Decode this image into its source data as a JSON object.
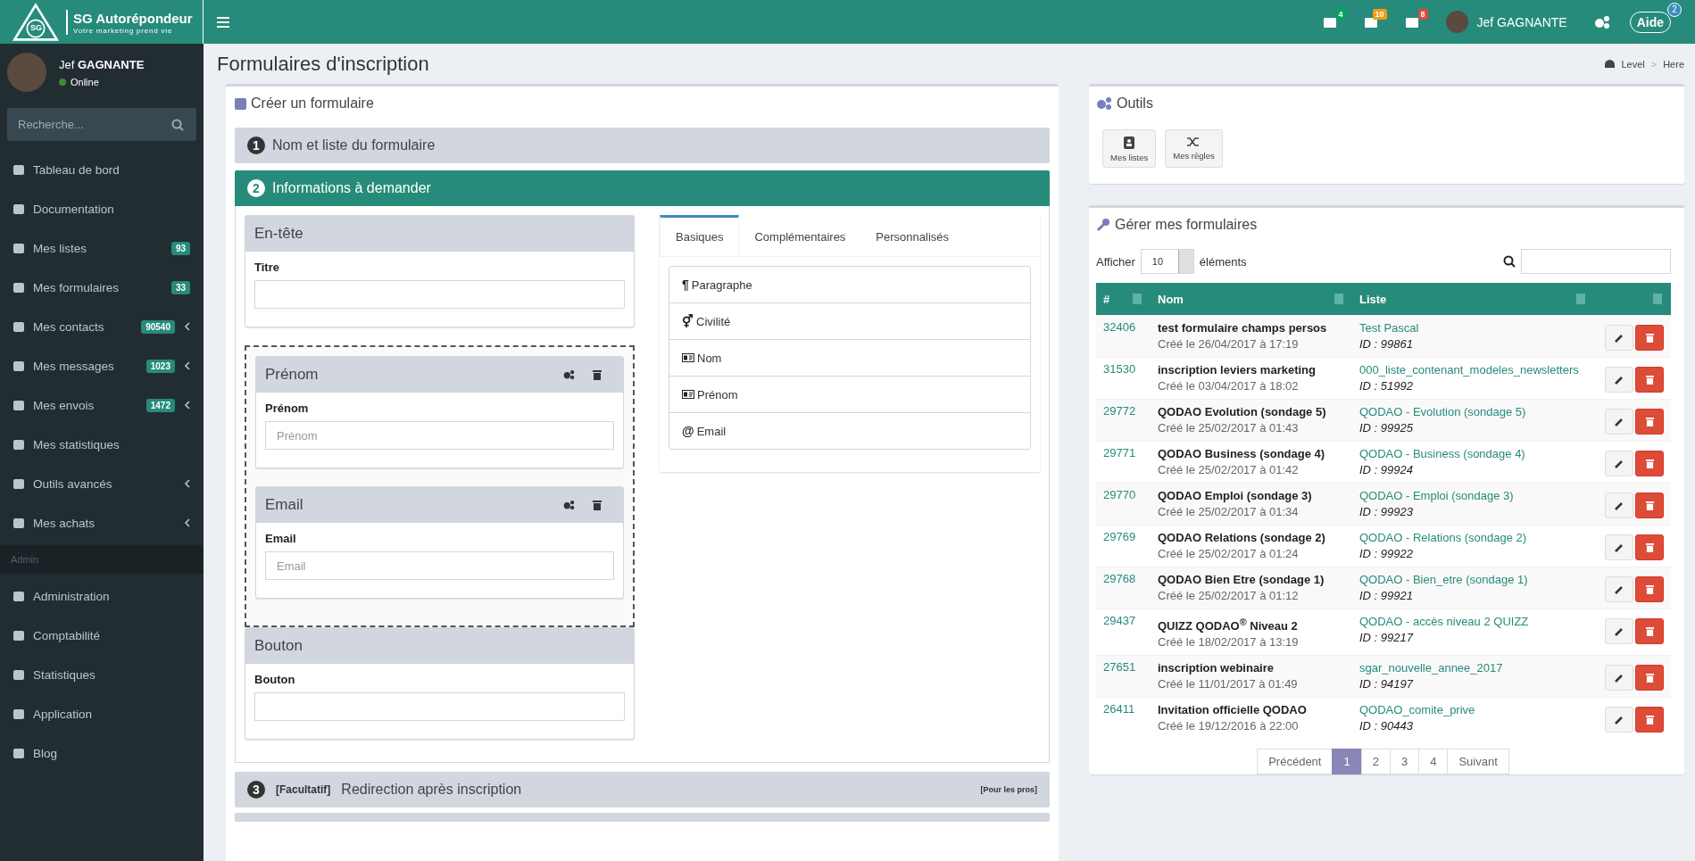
{
  "brand": {
    "mark": "SG",
    "name": "SG Autorépondeur",
    "tagline": "Votre marketing prend vie"
  },
  "topbar": {
    "notifications": [
      {
        "count": "4",
        "color": "#00a65a"
      },
      {
        "count": "10",
        "color": "#f39c12"
      },
      {
        "count": "8",
        "color": "#dd4b39"
      }
    ],
    "user": "Jef GAGNANTE",
    "help": {
      "label": "Aide",
      "badge": "2"
    }
  },
  "sidebar": {
    "user": {
      "first": "Jef",
      "last": "GAGNANTE",
      "status": "Online"
    },
    "search": {
      "placeholder": "Recherche..."
    },
    "items": [
      {
        "label": "Tableau de bord",
        "expandable": false
      },
      {
        "label": "Documentation",
        "expandable": false
      },
      {
        "label": "Mes listes",
        "badge": "93",
        "expandable": false
      },
      {
        "label": "Mes formulaires",
        "badge": "33",
        "expandable": false
      },
      {
        "label": "Mes contacts",
        "badge": "90540",
        "expandable": true
      },
      {
        "label": "Mes messages",
        "badge": "1023",
        "expandable": true
      },
      {
        "label": "Mes envois",
        "badge": "1472",
        "expandable": true
      },
      {
        "label": "Mes statistiques",
        "expandable": false
      },
      {
        "label": "Outils avancés",
        "expandable": true
      },
      {
        "label": "Mes achats",
        "expandable": true
      }
    ],
    "admin_header": "Admin",
    "admin_items": [
      {
        "label": "Administration"
      },
      {
        "label": "Comptabilité"
      },
      {
        "label": "Statistiques"
      },
      {
        "label": "Application"
      },
      {
        "label": "Blog"
      }
    ]
  },
  "page": {
    "title": "Formulaires d'inscription",
    "breadcrumb": [
      "Level",
      "Here"
    ],
    "breadcrumb_separator": ">"
  },
  "create": {
    "title": "Créer un formulaire",
    "steps": [
      {
        "number": "1",
        "title": "Nom et liste du formulaire",
        "expanded": false
      },
      {
        "number": "2",
        "title": "Informations à demander",
        "expanded": true
      },
      {
        "number": "3",
        "title": "Redirection après inscription",
        "expanded": false,
        "tag": "[Facultatif]",
        "note": "[Pour les pros]"
      }
    ],
    "header_block": {
      "title": "En-tête",
      "label": "Titre"
    },
    "fields": [
      {
        "title": "Prénom",
        "label": "Prénom",
        "placeholder": "Prénom"
      },
      {
        "title": "Email",
        "label": "Email",
        "placeholder": "Email"
      }
    ],
    "button_block": {
      "title": "Bouton",
      "label": "Bouton"
    },
    "tabs": [
      {
        "label": "Basiques",
        "selected": true
      },
      {
        "label": "Complémentaires",
        "selected": false
      },
      {
        "label": "Personnalisés",
        "selected": false
      }
    ],
    "palette": [
      {
        "label": "Paragraphe",
        "kind": "paragraph",
        "icon": "¶"
      },
      {
        "label": "Civilité",
        "kind": "gender",
        "icon": "⚥"
      },
      {
        "label": "Nom",
        "kind": "card"
      },
      {
        "label": "Prénom",
        "kind": "card"
      },
      {
        "label": "Email",
        "kind": "at",
        "icon": "@"
      }
    ]
  },
  "tools": {
    "title": "Outils",
    "buttons": [
      {
        "label": "Mes listes",
        "kind": "contacts"
      },
      {
        "label": "Mes règles",
        "kind": "shuffle"
      }
    ]
  },
  "manage": {
    "title": "Gérer mes formulaires",
    "show_label": "Afficher",
    "page_size": "10",
    "elements_label": "éléments",
    "columns": [
      "#",
      "Nom",
      "Liste"
    ],
    "rows": [
      {
        "id": "32406",
        "name": "test formulaire champs persos",
        "created": "Créé le 26/04/2017 à 17:19",
        "list": "Test Pascal",
        "list_id": "ID : 99861"
      },
      {
        "id": "31530",
        "name": "inscription leviers marketing",
        "created": "Créé le 03/04/2017 à 18:02",
        "list": "000_liste_contenant_modeles_newsletters",
        "list_id": "ID : 51992"
      },
      {
        "id": "29772",
        "name": "QODAO Evolution (sondage 5)",
        "created": "Créé le 25/02/2017 à 01:43",
        "list": "QODAO - Evolution (sondage 5)",
        "list_id": "ID : 99925"
      },
      {
        "id": "29771",
        "name": "QODAO Business (sondage 4)",
        "created": "Créé le 25/02/2017 à 01:42",
        "list": "QODAO - Business (sondage 4)",
        "list_id": "ID : 99924"
      },
      {
        "id": "29770",
        "name": "QODAO Emploi (sondage 3)",
        "created": "Créé le 25/02/2017 à 01:34",
        "list": "QODAO - Emploi (sondage 3)",
        "list_id": "ID : 99923"
      },
      {
        "id": "29769",
        "name": "QODAO Relations (sondage 2)",
        "created": "Créé le 25/02/2017 à 01:24",
        "list": "QODAO - Relations (sondage 2)",
        "list_id": "ID : 99922"
      },
      {
        "id": "29768",
        "name": "QODAO Bien Etre (sondage 1)",
        "created": "Créé le 25/02/2017 à 01:12",
        "list": "QODAO - Bien_etre (sondage 1)",
        "list_id": "ID : 99921"
      },
      {
        "id": "29437",
        "name": "QUIZZ QODAO$^{®}$ Niveau 2",
        "created": "Créé le 18/02/2017 à 13:19",
        "list": "QODAO - accès niveau 2 QUIZZ",
        "list_id": "ID : 99217"
      },
      {
        "id": "27651",
        "name": "inscription webinaire",
        "created": "Créé le 11/01/2017 à 01:49",
        "list": "sgar_nouvelle_annee_2017",
        "list_id": "ID : 94197"
      },
      {
        "id": "26411",
        "name": "Invitation officielle QODAO",
        "created": "Créé le 19/12/2016 à 22:00",
        "list": "QODAO_comite_prive",
        "list_id": "ID : 90443"
      }
    ],
    "pagination": {
      "previous": "Précédent",
      "next": "Suivant",
      "pages": [
        {
          "label": "1",
          "selected": true
        },
        {
          "label": "2",
          "selected": false
        },
        {
          "label": "3",
          "selected": false
        },
        {
          "label": "4",
          "selected": false
        }
      ]
    }
  }
}
